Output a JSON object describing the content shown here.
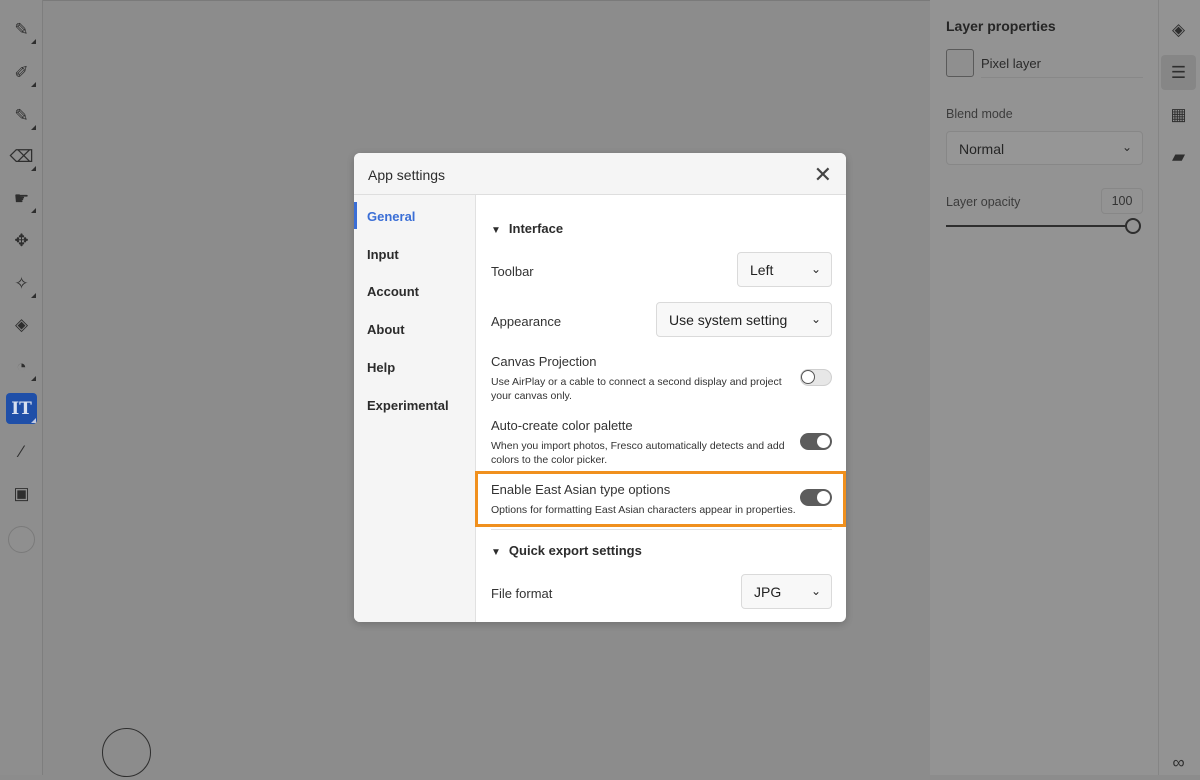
{
  "toolbar": {
    "tools": [
      {
        "name": "pixel-brush",
        "glyph": "✎"
      },
      {
        "name": "live-brush",
        "glyph": "✐"
      },
      {
        "name": "vector-brush",
        "glyph": "✎"
      },
      {
        "name": "eraser",
        "glyph": "⌫"
      },
      {
        "name": "smudge",
        "glyph": "☛"
      },
      {
        "name": "move-transform",
        "glyph": "✥"
      },
      {
        "name": "selection",
        "glyph": "✧"
      },
      {
        "name": "fill",
        "glyph": "◈"
      },
      {
        "name": "lasso",
        "glyph": "◔"
      },
      {
        "name": "type",
        "glyph": "IT"
      },
      {
        "name": "eyedropper",
        "glyph": "⁄"
      },
      {
        "name": "place-image",
        "glyph": "▣"
      }
    ],
    "active_tool": "type"
  },
  "layer_panel": {
    "title": "Layer properties",
    "layer_name": "Pixel layer",
    "blend_mode_label": "Blend mode",
    "blend_mode_value": "Normal",
    "opacity_label": "Layer opacity",
    "opacity_value": "100",
    "opacity_fraction": 1.0
  },
  "dialog": {
    "title": "App settings",
    "nav": [
      "General",
      "Input",
      "Account",
      "About",
      "Help",
      "Experimental"
    ],
    "active_nav": "General",
    "interface_section": "Interface",
    "toolbar_label": "Toolbar",
    "toolbar_value": "Left",
    "appearance_label": "Appearance",
    "appearance_value": "Use system setting",
    "canvas_projection": {
      "label": "Canvas Projection",
      "desc": "Use AirPlay or a cable to connect a second display and project your canvas only.",
      "on": false
    },
    "auto_palette": {
      "label": "Auto-create color palette",
      "desc": "When you import photos, Fresco automatically detects and add colors to the color picker.",
      "on": true
    },
    "east_asian": {
      "label": "Enable East Asian type options",
      "desc": "Options for formatting East Asian characters appear in properties.",
      "on": true
    },
    "export_section": "Quick export settings",
    "file_format_label": "File format",
    "file_format_value": "JPG"
  },
  "colors": {
    "highlight": "#f0901e",
    "accent": "#3a6ed6",
    "active_tool": "#1f4fa8"
  }
}
